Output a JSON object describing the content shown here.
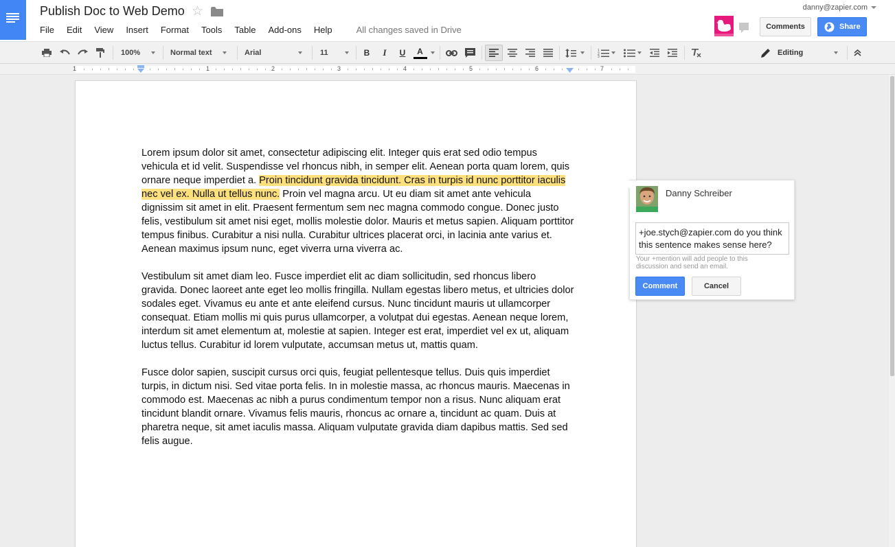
{
  "header": {
    "title": "Publish Doc to Web Demo",
    "save_status": "All changes saved in Drive",
    "user_email": "danny@zapier.com",
    "comments_label": "Comments",
    "share_label": "Share"
  },
  "menu": [
    "File",
    "Edit",
    "View",
    "Insert",
    "Format",
    "Tools",
    "Table",
    "Add-ons",
    "Help"
  ],
  "toolbar": {
    "zoom": "100%",
    "style": "Normal text",
    "font": "Arial",
    "size": "11",
    "bold": "B",
    "italic": "I",
    "underline": "U",
    "text_color": "A",
    "mode": "Editing"
  },
  "ruler": [
    "1",
    "1",
    "2",
    "3",
    "4",
    "5",
    "6",
    "7"
  ],
  "document": {
    "paragraphs": [
      {
        "before": "Lorem ipsum dolor sit amet, consectetur adipiscing elit. Integer quis erat sed odio tempus vehicula et id velit. Suspendisse vel rhoncus nibh, in semper elit. Aenean porta quam lorem, quis ornare neque imperdiet a. ",
        "highlight": "Proin tincidunt gravida tincidunt. Cras in turpis id nunc porttitor iaculis nec vel ex. Nulla ut tellus nunc.",
        "after": " Proin vel magna arcu. Ut eu diam sit amet ante vehicula dignissim sit amet in elit. Praesent fermentum sem nec magna commodo congue. Donec justo felis, vestibulum sit amet nisi eget, mollis molestie dolor. Mauris et metus sapien. Aliquam porttitor tempus finibus. Curabitur a nisi nulla. Curabitur ultrices placerat orci, in lacinia ante varius et. Aenean maximus ipsum nunc, eget viverra urna viverra ac."
      },
      {
        "text": "Vestibulum sit amet diam leo. Fusce imperdiet elit ac diam sollicitudin, sed rhoncus libero gravida. Donec laoreet ante eget leo mollis fringilla. Nullam egestas libero metus, et ultricies dolor sodales eget. Vivamus eu ante et ante eleifend cursus. Nunc tincidunt mauris ut ullamcorper consequat. Etiam mollis mi quis purus ullamcorper, a volutpat dui egestas. Aenean neque lorem, interdum sit amet elementum at, molestie at sapien. Integer est erat, imperdiet vel ex ut, aliquam luctus tellus. Curabitur id lorem vulputate, accumsan metus ut, mattis quam."
      },
      {
        "text": "Fusce dolor sapien, suscipit cursus orci quis, feugiat pellentesque tellus. Duis quis imperdiet turpis, in dictum nisi. Sed vitae porta felis. In in molestie massa, ac rhoncus mauris. Maecenas in commodo est. Maecenas ac nibh a purus condimentum tempor non a risus. Nunc aliquam erat tincidunt blandit ornare. Vivamus felis mauris, rhoncus ac ornare a, tincidunt ac quam. Duis at pharetra neque, sit amet iaculis massa. Aliquam vulputate gravida diam dapibus mattis. Sed sed felis augue."
      }
    ]
  },
  "comment": {
    "author": "Danny Schreiber",
    "text": "+joe.stych@zapier.com do you think this sentence makes sense here?",
    "hint": "Your +mention will add people to this discussion and send an email.",
    "submit_label": "Comment",
    "cancel_label": "Cancel"
  },
  "colors": {
    "brand_blue": "#4285f4",
    "highlight": "#fde07c",
    "share_blue": "#4a8af4",
    "zapier_pink": "#e8197d"
  }
}
